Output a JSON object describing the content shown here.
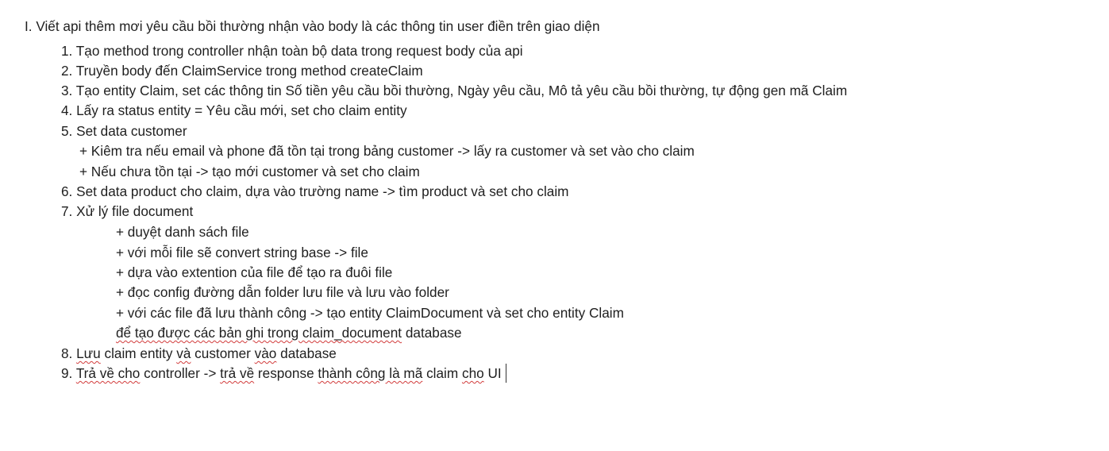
{
  "document": {
    "heading": "I. Viết api thêm mơi yêu cầu bồi thường nhận vào body là các thông tin user điền trên giao diện",
    "steps": [
      "1. Tạo method trong controller nhận toàn bộ data trong request body của api",
      "2. Truyền body đến ClaimService trong method createClaim",
      "3. Tạo entity Claim, set các thông tin Số tiền yêu cầu bồi thường, Ngày yêu cầu, Mô tả yêu cầu bồi thường, tự động gen mã Claim",
      "4. Lấy ra status entity = Yêu cầu mới, set cho claim entity",
      "5. Set data customer",
      "+ Kiêm tra nếu email và phone đã tồn tại trong bảng customer -> lấy ra customer và set vào cho claim",
      "+ Nếu chưa tồn tại -> tạo mới customer và set cho claim",
      "6. Set data product cho claim, dựa vào trường name -> tìm product và set cho claim",
      "7. Xử lý file document",
      "+ duyệt danh sách file",
      "+ với mỗi file sẽ convert string base -> file",
      "+ dựa vào extention của file để tạo ra đuôi file",
      "+ đọc config đường dẫn folder lưu file và lưu vào folder",
      "+ với các file đã lưu thành công -> tạo entity ClaimDocument và set cho entity Claim"
    ],
    "continuation": {
      "underlined": "để tạo được các bản ghi trong claim_document",
      "rest": " database"
    },
    "step8": {
      "num": "8. ",
      "w1": "Lưu",
      "t1": " claim entity ",
      "w2": "và",
      "t2": " customer ",
      "w3": "vào",
      "t3": " database"
    },
    "step9": {
      "num": "9. ",
      "w1": "Trả về cho",
      "t1": " controller -> ",
      "w2": "trả về",
      "t2": " response ",
      "w3": "thành công là mã",
      "t3": " claim ",
      "w4": "cho",
      "t4": " UI"
    }
  }
}
